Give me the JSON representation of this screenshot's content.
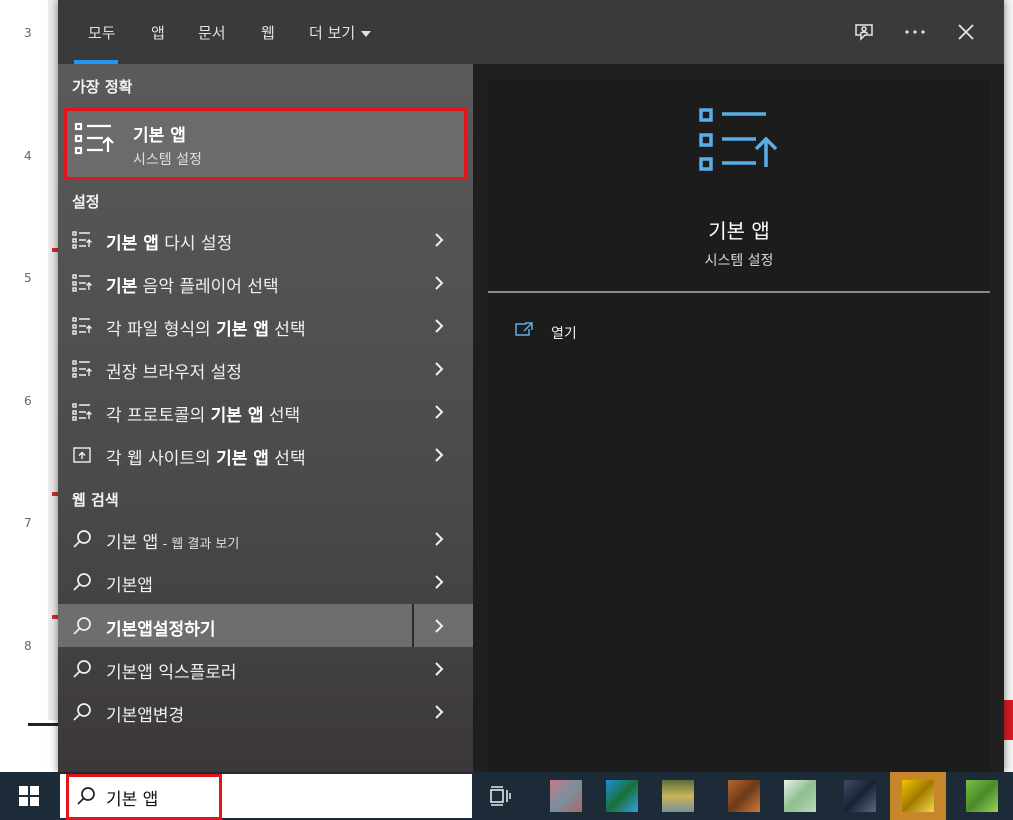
{
  "background_document": {
    "line_numbers": [
      "3",
      "4",
      "5",
      "6",
      "7",
      "8"
    ]
  },
  "top_tabs": {
    "all": "모두",
    "apps": "앱",
    "documents": "문서",
    "web": "웹",
    "more": "더 보기"
  },
  "top_icons": [
    "feedback-icon",
    "more-options-icon",
    "close-icon"
  ],
  "sections": {
    "best_match": "가장 정확",
    "settings": "설정",
    "web_search": "웹 검색"
  },
  "best_match": {
    "title": "기본 앱",
    "subtitle": "시스템 설정",
    "icon": "default-apps-icon"
  },
  "settings_items": [
    {
      "bold": "기본 앱",
      "rest": " 다시 설정",
      "icon": "default-apps-icon"
    },
    {
      "bold": "기본",
      "rest": " 음악 플레이어 선택",
      "icon": "default-apps-icon"
    },
    {
      "prefix": "각 파일 형식의 ",
      "bold": "기본 앱",
      "rest": " 선택",
      "icon": "default-apps-icon"
    },
    {
      "prefix": "권장 브라우저 설정",
      "bold": "",
      "rest": "",
      "icon": "default-apps-icon"
    },
    {
      "prefix": "각 프로토콜의 ",
      "bold": "기본 앱",
      "rest": " 선택",
      "icon": "default-apps-icon"
    },
    {
      "prefix": "각 웹 사이트의 ",
      "bold": "기본 앱",
      "rest": " 선택",
      "icon": "web-apps-icon"
    }
  ],
  "web_items": [
    {
      "main": "기본 앱",
      "suffix": " - 웹 결과 보기",
      "icon": "search-icon"
    },
    {
      "main": "기본앱",
      "suffix": "",
      "icon": "search-icon"
    },
    {
      "main": "기본앱설정하기",
      "suffix": "",
      "icon": "search-icon",
      "selected": true
    },
    {
      "main": "기본앱 익스플로러",
      "suffix": "",
      "icon": "search-icon"
    },
    {
      "main": "기본앱변경",
      "suffix": "",
      "icon": "search-icon"
    }
  ],
  "preview": {
    "title": "기본 앱",
    "subtitle": "시스템 설정",
    "open_label": "열기",
    "icon": "default-apps-icon"
  },
  "taskbar": {
    "search_value": "기본 앱",
    "apps": [
      {
        "icon": "app-icon-1",
        "color": "#c9778a"
      },
      {
        "icon": "app-icon-2",
        "color": "#1a8fd6"
      },
      {
        "icon": "app-icon-3",
        "color": "#c9b45a"
      },
      {
        "icon": "app-icon-4",
        "color": "#b8652a"
      },
      {
        "icon": "app-icon-5",
        "color": "#b8d8b8"
      },
      {
        "icon": "app-icon-6",
        "color": "#3d4a6a"
      },
      {
        "icon": "app-icon-7",
        "color": "#f2c200"
      },
      {
        "icon": "app-icon-8",
        "color": "#7bc043"
      }
    ]
  },
  "colors": {
    "accent": "#2196f3",
    "highlight_box": "#e0161c",
    "icon_blue": "#5aaee8"
  }
}
